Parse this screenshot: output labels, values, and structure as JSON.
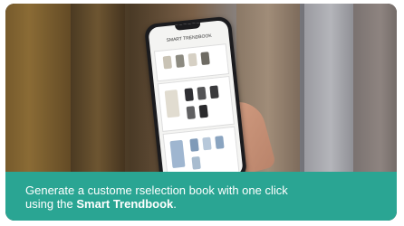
{
  "caption": {
    "line1": "Generate a custome rselection book with one click",
    "line2_prefix": "using the ",
    "line2_bold": "Smart Trendbook",
    "line2_suffix": "."
  },
  "phone": {
    "app_title": "SMART TRENDBOOK"
  },
  "colors": {
    "caption_bg": "#2aa593",
    "caption_text": "#ffffff"
  }
}
